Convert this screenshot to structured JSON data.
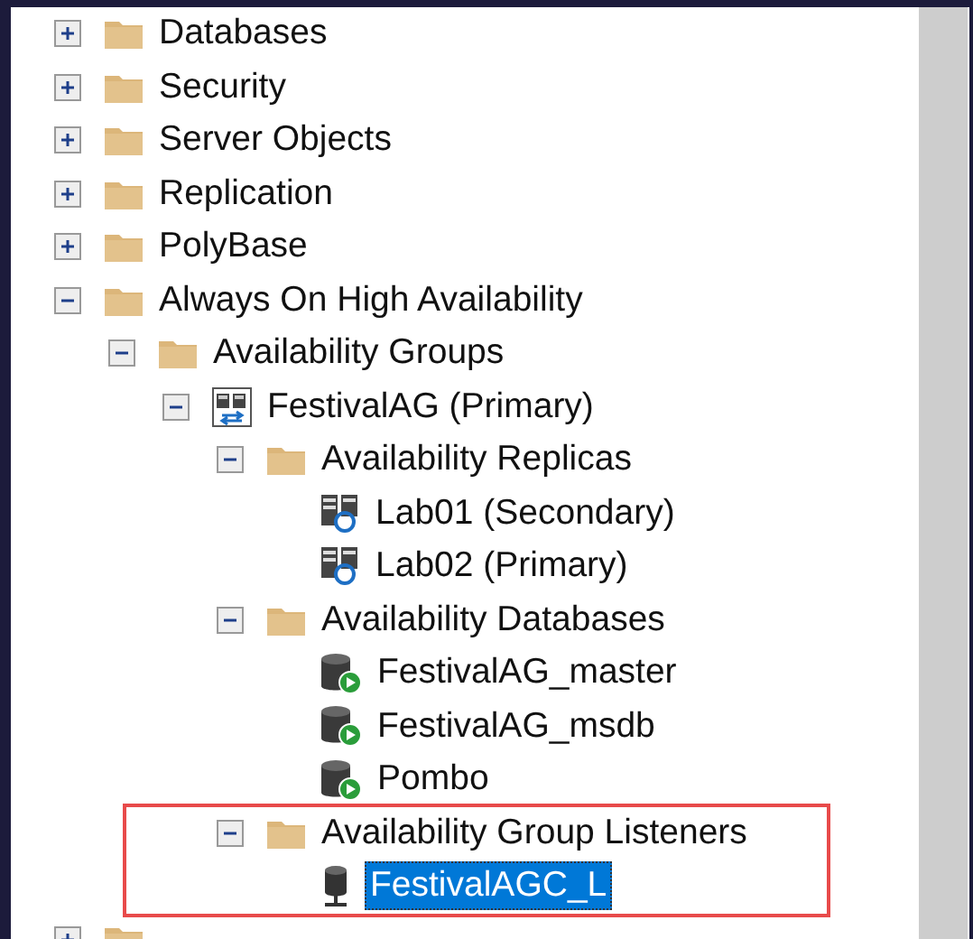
{
  "tree": [
    {
      "kind": "folder",
      "label": "Databases",
      "expanded": false,
      "selected": false
    },
    {
      "kind": "folder",
      "label": "Security",
      "expanded": false,
      "selected": false
    },
    {
      "kind": "folder",
      "label": "Server Objects",
      "expanded": false,
      "selected": false
    },
    {
      "kind": "folder",
      "label": "Replication",
      "expanded": false,
      "selected": false
    },
    {
      "kind": "folder",
      "label": "PolyBase",
      "expanded": false,
      "selected": false
    },
    {
      "kind": "folder",
      "label": "Always On High Availability",
      "expanded": true,
      "selected": false,
      "children": [
        {
          "kind": "folder",
          "label": "Availability Groups",
          "expanded": true,
          "selected": false,
          "children": [
            {
              "kind": "group",
              "label": "FestivalAG (Primary)",
              "expanded": true,
              "selected": false,
              "children": [
                {
                  "kind": "folder",
                  "label": "Availability Replicas",
                  "expanded": true,
                  "selected": false,
                  "children": [
                    {
                      "kind": "replica",
                      "label": "Lab01 (Secondary)",
                      "selected": false
                    },
                    {
                      "kind": "replica",
                      "label": "Lab02 (Primary)",
                      "selected": false
                    }
                  ]
                },
                {
                  "kind": "folder",
                  "label": "Availability Databases",
                  "expanded": true,
                  "selected": false,
                  "children": [
                    {
                      "kind": "database",
                      "label": "FestivalAG_master",
                      "selected": false
                    },
                    {
                      "kind": "database",
                      "label": "FestivalAG_msdb",
                      "selected": false
                    },
                    {
                      "kind": "database",
                      "label": "Pombo",
                      "selected": false
                    }
                  ]
                },
                {
                  "kind": "folder",
                  "label": "Availability Group Listeners",
                  "expanded": true,
                  "selected": false,
                  "highlighted": true,
                  "children": [
                    {
                      "kind": "listener",
                      "label": "FestivalAGC_L",
                      "selected": true
                    }
                  ]
                }
              ]
            }
          ]
        }
      ]
    },
    {
      "kind": "folder",
      "expanded": false
    }
  ]
}
